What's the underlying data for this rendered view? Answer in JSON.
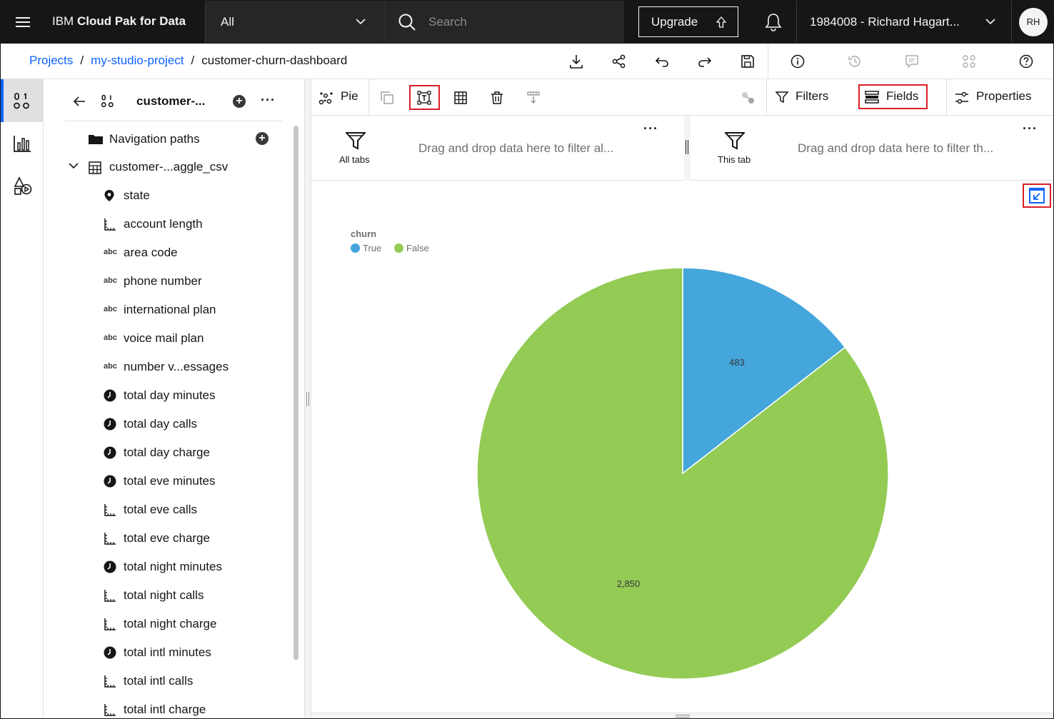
{
  "header": {
    "brand_prefix": "IBM",
    "brand_name": "Cloud Pak for Data",
    "scope_value": "All",
    "search_placeholder": "Search",
    "upgrade_label": "Upgrade",
    "account_label": "1984008 - Richard Hagart...",
    "avatar_initials": "RH"
  },
  "breadcrumb": {
    "items": [
      "Projects",
      "my-studio-project",
      "customer-churn-dashboard"
    ],
    "separator": "/"
  },
  "data_panel": {
    "title": "customer-...",
    "nav_paths_label": "Navigation paths",
    "table_label": "customer-...aggle_csv",
    "fields": [
      {
        "label": "state",
        "icon": "location-icon"
      },
      {
        "label": "account length",
        "icon": "measure-icon"
      },
      {
        "label": "area code",
        "icon": "text-abc-icon"
      },
      {
        "label": "phone number",
        "icon": "text-abc-icon"
      },
      {
        "label": "international plan",
        "icon": "text-abc-icon"
      },
      {
        "label": "voice mail plan",
        "icon": "text-abc-icon"
      },
      {
        "label": "number v...essages",
        "icon": "text-abc-icon"
      },
      {
        "label": "total day minutes",
        "icon": "time-icon"
      },
      {
        "label": "total day calls",
        "icon": "time-icon"
      },
      {
        "label": "total day charge",
        "icon": "time-icon"
      },
      {
        "label": "total eve minutes",
        "icon": "time-icon"
      },
      {
        "label": "total eve calls",
        "icon": "measure-icon"
      },
      {
        "label": "total eve charge",
        "icon": "measure-icon"
      },
      {
        "label": "total night minutes",
        "icon": "time-icon"
      },
      {
        "label": "total night calls",
        "icon": "measure-icon"
      },
      {
        "label": "total night charge",
        "icon": "measure-icon"
      },
      {
        "label": "total intl minutes",
        "icon": "time-icon"
      },
      {
        "label": "total intl calls",
        "icon": "measure-icon"
      },
      {
        "label": "total intl charge",
        "icon": "measure-icon"
      }
    ],
    "abc_glyph": "abc"
  },
  "widget_toolbar": {
    "chart_type_label": "Pie",
    "filters_label": "Filters",
    "fields_label": "Fields",
    "properties_label": "Properties"
  },
  "filters": {
    "all_tabs_label": "All tabs",
    "all_tabs_placeholder": "Drag and drop data here to filter al...",
    "this_tab_label": "This tab",
    "this_tab_placeholder": "Drag and drop data here to filter th..."
  },
  "colors": {
    "true_color": "#44a6db",
    "false_color": "#93cb54",
    "accent": "#0f62fe",
    "highlight": "#da1e28"
  },
  "chart_data": {
    "type": "pie",
    "legend_title": "churn",
    "legend_position": "top-left",
    "slices": [
      {
        "name": "True",
        "value": 483,
        "label": "483",
        "color": "#44a6db"
      },
      {
        "name": "False",
        "value": 2850,
        "label": "2,850",
        "color": "#93cb54"
      }
    ]
  }
}
